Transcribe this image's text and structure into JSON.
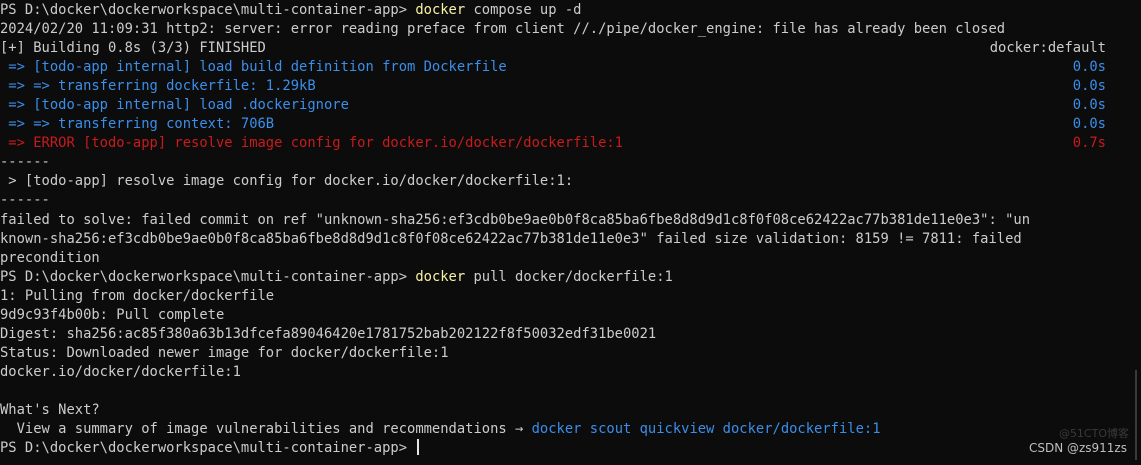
{
  "lines": {
    "l1_prompt": "PS D:\\docker\\dockerworkspace\\multi-container-app> ",
    "l1_cmd": "docker",
    "l1_args": " compose up -d",
    "l2": "2024/02/20 11:09:31 http2: server: error reading preface from client //./pipe/docker_engine: file has already been closed",
    "l3_left": "[+] Building 0.8s (3/3) FINISHED",
    "l3_right": "docker:default",
    "l4_left": " => [todo-app internal] load build definition from Dockerfile",
    "l4_right": "0.0s",
    "l5_left": " => => transferring dockerfile: 1.29kB",
    "l5_right": "0.0s",
    "l6_left": " => [todo-app internal] load .dockerignore",
    "l6_right": "0.0s",
    "l7_left": " => => transferring context: 706B",
    "l7_right": "0.0s",
    "l8_left": " => ERROR [todo-app] resolve image config for docker.io/docker/dockerfile:1",
    "l8_right": "0.7s",
    "l9": "------",
    "l10": " > [todo-app] resolve image config for docker.io/docker/dockerfile:1:",
    "l11": "------",
    "l12": "failed to solve: failed commit on ref \"unknown-sha256:ef3cdb0be9ae0b0f8ca85ba6fbe8d8d9d1c8f0f08ce62422ac77b381de11e0e3\": \"un",
    "l13": "known-sha256:ef3cdb0be9ae0b0f8ca85ba6fbe8d8d9d1c8f0f08ce62422ac77b381de11e0e3\" failed size validation: 8159 != 7811: failed",
    "l14": "precondition",
    "l15_prompt": "PS D:\\docker\\dockerworkspace\\multi-container-app> ",
    "l15_cmd": "docker",
    "l15_args": " pull docker/dockerfile:1",
    "l16": "1: Pulling from docker/dockerfile",
    "l17": "9d9c93f4b00b: Pull complete",
    "l18": "Digest: sha256:ac85f380a63b13dfcefa89046420e1781752bab202122f8f50032edf31be0021",
    "l19": "Status: Downloaded newer image for docker/dockerfile:1",
    "l20": "docker.io/docker/dockerfile:1",
    "l21": "",
    "l22": "What's Next?",
    "l23_left": "  View a summary of image vulnerabilities and recommendations → ",
    "l23_link": "docker scout quickview docker/dockerfile:1",
    "l24_prompt": "PS D:\\docker\\dockerworkspace\\multi-container-app> "
  },
  "watermark": {
    "csdn": "CSDN @zs911zs",
    "site": "@51CTO博客"
  },
  "colors": {
    "background": "#0c0c0c",
    "text": "#cccccc",
    "info_blue": "#3b8eea",
    "error_red": "#c91b1b",
    "command_yellow": "#f9f1a5"
  }
}
